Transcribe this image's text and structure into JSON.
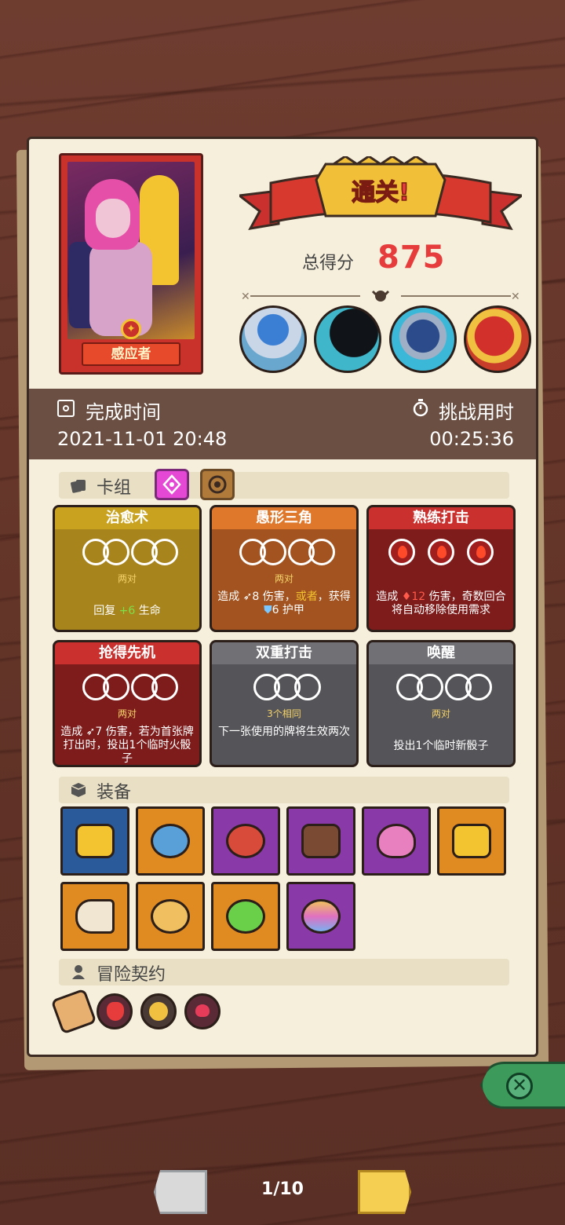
{
  "hero": {
    "name": "感应者"
  },
  "result": {
    "title": "通关!",
    "score_label": "总得分",
    "score": "875"
  },
  "bosses": [
    "mushroom-sage",
    "shadow-beast",
    "armored-knight",
    "red-demon"
  ],
  "completion": {
    "label": "完成时间",
    "value": "2021-11-01 20:48"
  },
  "challenge": {
    "label": "挑战用时",
    "value": "00:25:36"
  },
  "deck": {
    "title": "卡组",
    "cards": [
      {
        "title": "治愈术",
        "req": "两对",
        "desc_a": "回复 ",
        "desc_hl": "+6",
        "desc_b": " 生命"
      },
      {
        "title": "愚形三角",
        "req": "两对",
        "d1": "造成 ",
        "d2": "8",
        "d3": " 伤害，",
        "d4": "或者",
        "d5": "，获得 ",
        "d6": "6",
        "d7": " 护甲"
      },
      {
        "title": "熟练打击",
        "req": "",
        "d1": "造成 ",
        "d2": "12",
        "d3": " 伤害，奇数回合将自动移除使用需求"
      },
      {
        "title": "抢得先机",
        "req": "两对",
        "desc": "造成 ➶7 伤害，若为首张牌打出时，投出1个临时火骰子"
      },
      {
        "title": "双重打击",
        "req": "3个相同",
        "desc": "下一张使用的牌将生效两次"
      },
      {
        "title": "唤醒",
        "req": "两对",
        "desc": "投出1个临时新骰子"
      }
    ]
  },
  "equipment": {
    "title": "装备",
    "items": [
      "golden-crown-helmet",
      "battle-axe",
      "spiked-collar",
      "fire-stone",
      "heart-amulet",
      "golden-cross",
      "horn",
      "eye-coin",
      "green-potion",
      "crystal-orb"
    ]
  },
  "contracts": {
    "title": "冒险契约",
    "items": [
      "scroll",
      "red-demon-contract",
      "gold-coin-contract",
      "heart-contract"
    ]
  },
  "pagination": {
    "page": "1/10"
  },
  "colors": {
    "score": "#e63c3c",
    "paper": "#f6efdc",
    "timebar": "#6b4f43"
  }
}
